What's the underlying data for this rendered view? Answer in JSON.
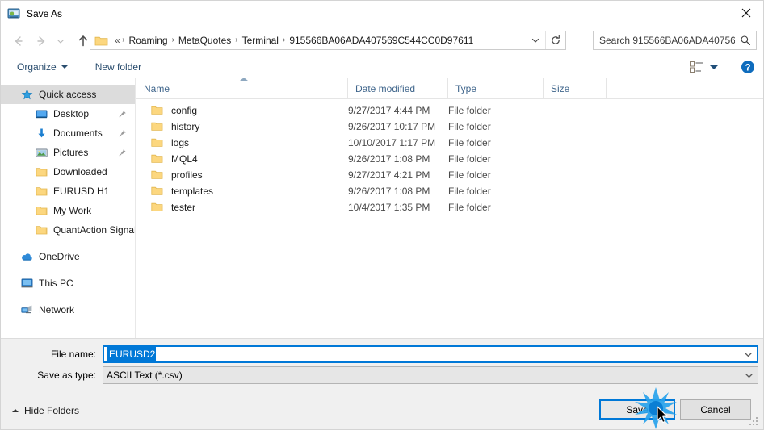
{
  "window": {
    "title": "Save As",
    "icon": "app-icon",
    "close_label": "×"
  },
  "navigation": {
    "back_icon": "arrow-left-icon",
    "forward_icon": "arrow-right-icon",
    "recent_icon": "chevron-down-icon",
    "up_icon": "arrow-up-icon",
    "address": {
      "folder_icon": "folder-icon",
      "lead": "«",
      "crumbs": [
        "Roaming",
        "MetaQuotes",
        "Terminal",
        "915566BA06ADA407569C544CC0D97611"
      ],
      "separator": "›",
      "dropdown_icon": "chevron-down-icon",
      "refresh_icon": "refresh-icon"
    },
    "search": {
      "placeholder": "Search 915566BA06ADA40756...",
      "icon": "search-icon"
    }
  },
  "toolbar": {
    "organize_label": "Organize",
    "new_folder_label": "New folder",
    "view_icon": "view-options-icon",
    "help_icon": "help-icon"
  },
  "sidebar": {
    "items": [
      {
        "label": "Quick access",
        "icon": "star-icon",
        "level": 0,
        "selected": true,
        "pinned": false
      },
      {
        "label": "Desktop",
        "icon": "desktop-icon",
        "level": 1,
        "selected": false,
        "pinned": true
      },
      {
        "label": "Documents",
        "icon": "documents-download-icon",
        "level": 1,
        "selected": false,
        "pinned": true
      },
      {
        "label": "Pictures",
        "icon": "pictures-icon",
        "level": 1,
        "selected": false,
        "pinned": true
      },
      {
        "label": "Downloaded",
        "icon": "folder-icon",
        "level": 1,
        "selected": false,
        "pinned": false
      },
      {
        "label": "EURUSD H1",
        "icon": "folder-icon",
        "level": 1,
        "selected": false,
        "pinned": false
      },
      {
        "label": "My Work",
        "icon": "folder-icon",
        "level": 1,
        "selected": false,
        "pinned": false
      },
      {
        "label": "QuantAction Signal",
        "icon": "folder-icon",
        "level": 1,
        "selected": false,
        "pinned": false
      },
      {
        "label": "OneDrive",
        "icon": "onedrive-cloud-icon",
        "level": 0,
        "selected": false,
        "pinned": false,
        "gap_before": true
      },
      {
        "label": "This PC",
        "icon": "this-pc-icon",
        "level": 0,
        "selected": false,
        "pinned": false,
        "gap_before": true
      },
      {
        "label": "Network",
        "icon": "network-icon",
        "level": 0,
        "selected": false,
        "pinned": false,
        "gap_before": true
      }
    ]
  },
  "file_list": {
    "columns": [
      {
        "key": "name",
        "label": "Name",
        "sorted": "asc"
      },
      {
        "key": "date",
        "label": "Date modified",
        "sorted": ""
      },
      {
        "key": "type",
        "label": "Type",
        "sorted": ""
      },
      {
        "key": "size",
        "label": "Size",
        "sorted": ""
      }
    ],
    "rows": [
      {
        "icon": "folder-icon",
        "name": "config",
        "date": "9/27/2017 4:44 PM",
        "type": "File folder",
        "size": ""
      },
      {
        "icon": "folder-icon",
        "name": "history",
        "date": "9/26/2017 10:17 PM",
        "type": "File folder",
        "size": ""
      },
      {
        "icon": "folder-icon",
        "name": "logs",
        "date": "10/10/2017 1:17 PM",
        "type": "File folder",
        "size": ""
      },
      {
        "icon": "folder-icon",
        "name": "MQL4",
        "date": "9/26/2017 1:08 PM",
        "type": "File folder",
        "size": ""
      },
      {
        "icon": "folder-icon",
        "name": "profiles",
        "date": "9/27/2017 4:21 PM",
        "type": "File folder",
        "size": ""
      },
      {
        "icon": "folder-icon",
        "name": "templates",
        "date": "9/26/2017 1:08 PM",
        "type": "File folder",
        "size": ""
      },
      {
        "icon": "folder-icon",
        "name": "tester",
        "date": "10/4/2017 1:35 PM",
        "type": "File folder",
        "size": ""
      }
    ]
  },
  "form": {
    "file_name_label": "File name:",
    "file_name_value": "EURUSD2",
    "save_as_type_label": "Save as type:",
    "save_as_type_value": "ASCII Text (*.csv)",
    "dropdown_icon": "chevron-down-icon"
  },
  "footer": {
    "hide_folders_label": "Hide Folders",
    "save_label": "Save",
    "cancel_label": "Cancel",
    "resize_grip_icon": "resize-grip-icon",
    "cursor_icon": "mouse-pointer-icon",
    "click_effect_icon": "click-burst-icon"
  },
  "colors": {
    "accent": "#0078d7",
    "folder_yellow": "#fdd06a",
    "header_text": "#40668c",
    "chrome_bg": "#f0f0f0"
  }
}
